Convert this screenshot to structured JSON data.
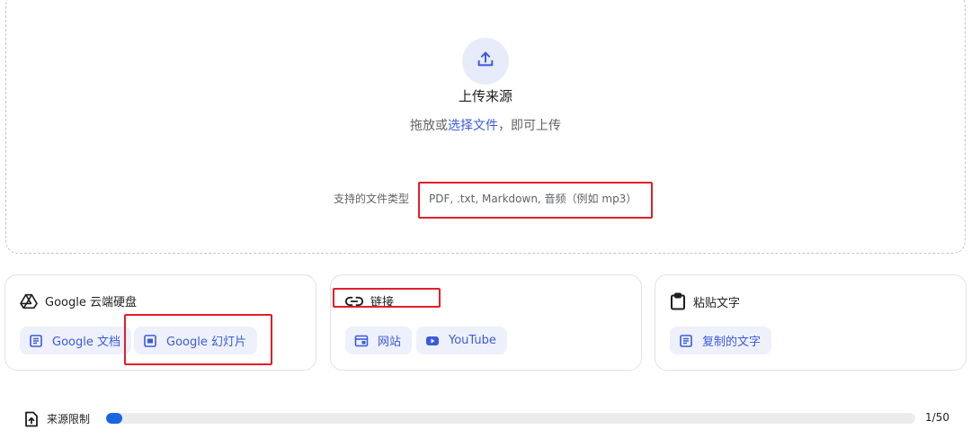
{
  "upload": {
    "title": "上传来源",
    "hint_prefix": "拖放或",
    "hint_link": "选择文件",
    "hint_suffix": "，即可上传",
    "types_label": "支持的文件类型",
    "types_value": "PDF, .txt, Markdown, 音频（例如 mp3）",
    "icon": "upload-icon"
  },
  "cards": {
    "drive": {
      "title": "Google 云端硬盘",
      "icon": "google-drive-icon",
      "items": [
        {
          "label": "Google 文档",
          "icon": "document-icon"
        },
        {
          "label": "Google 幻灯片",
          "icon": "slides-icon"
        }
      ]
    },
    "link": {
      "title": "链接",
      "icon": "link-icon",
      "items": [
        {
          "label": "网站",
          "icon": "website-icon"
        },
        {
          "label": "YouTube",
          "icon": "youtube-icon"
        }
      ]
    },
    "paste": {
      "title": "粘贴文字",
      "icon": "clipboard-icon",
      "items": [
        {
          "label": "复制的文字",
          "icon": "document-icon"
        }
      ]
    }
  },
  "footer": {
    "label": "来源限制",
    "count": "1/50",
    "progress": 0.02,
    "icon": "source-upload-icon",
    "accent": "#1a66e0"
  },
  "colors": {
    "accent": "#3b5bdb",
    "chip_bg": "#eef1fb",
    "highlight": "#e0202a"
  }
}
